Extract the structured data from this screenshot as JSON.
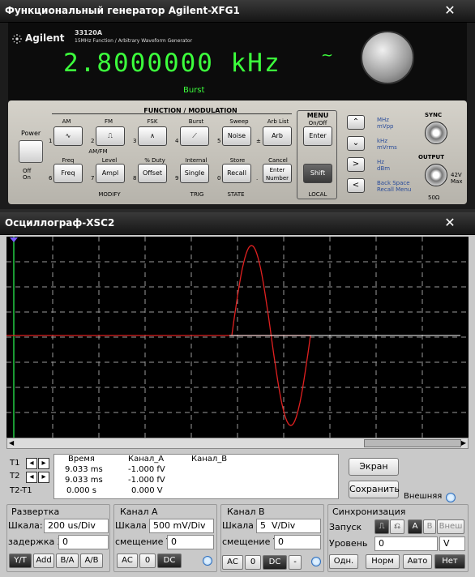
{
  "generator": {
    "title": "Функциональный генератор Agilent-XFG1",
    "close_glyph": "✕",
    "brand": "Agilent",
    "model": "33120A",
    "model_sub": "15MHz Function / Arbitrary Waveform Generator",
    "frequency": "2.8000000 kHz",
    "wave_symbol": "~",
    "burst": "Burst",
    "power_label": "Power",
    "off_label": "Off",
    "on_label": "On",
    "headers": {
      "function_modulation": "FUNCTION / MODULATION",
      "am_fm": "AM/FM",
      "modify": "MODIFY",
      "trig": "TRIG",
      "state": "STATE",
      "menu": "MENU",
      "menu_sub": "On/Off",
      "local": "LOCAL",
      "sync": "SYNC",
      "output": "OUTPUT",
      "ohm": "50Ω",
      "max": "42V Max"
    },
    "top_labels": [
      "AM",
      "FM",
      "FSK",
      "Burst",
      "Sweep",
      "Arb List"
    ],
    "top_buttons": [
      "∿",
      "⎍",
      "∧",
      "⟋",
      "Noise",
      "Arb"
    ],
    "top_numbers": [
      "1",
      "2",
      "3",
      "4",
      "5",
      "±"
    ],
    "bottom_labels": [
      "Freq",
      "Level",
      "% Duty",
      "Internal",
      "Store",
      "Cancel"
    ],
    "bottom_buttons": [
      "Freq",
      "Ampl",
      "Offset",
      "Single",
      "Recall",
      "Enter Number"
    ],
    "bottom_numbers": [
      "6",
      "7",
      "8",
      "9",
      "0",
      "."
    ],
    "enter": "Enter",
    "shift": "Shift",
    "arrows": [
      "⌃",
      "⌄",
      ">",
      "<"
    ],
    "side_labels": [
      "MHz\nmVpp",
      "kHz\nmVrms",
      "Hz\ndBm",
      "Back Space\nRecall Menu"
    ]
  },
  "oscilloscope": {
    "title": "Осциллограф-XSC2",
    "close_glyph": "✕",
    "meas_headers": [
      "Время",
      "Канал_A",
      "Канал_B"
    ],
    "rows": [
      {
        "label": "T1",
        "time": "9.033 ms",
        "a": "-1.000 fV",
        "b": ""
      },
      {
        "label": "T2",
        "time": "9.033 ms",
        "a": "-1.000 fV",
        "b": ""
      },
      {
        "label": "T2-T1",
        "time": "0.000 s",
        "a": "0.000 V",
        "b": ""
      }
    ],
    "screen_btn": "Экран",
    "save_btn": "Сохранить",
    "external": "Внешняя",
    "timebase": {
      "title": "Развертка",
      "scale_label": "Шкала:",
      "scale_value": "200 us/Div",
      "delay_label": "задержка X",
      "delay_value": "0",
      "buttons": [
        "Y/T",
        "Add",
        "B/A",
        "A/B"
      ]
    },
    "channel_a": {
      "title": "Канал A",
      "scale_label": "Шкала",
      "scale_value": "500 mV/Div",
      "offset_label": "смещение Y",
      "offset_value": "0",
      "buttons": [
        "AC",
        "0",
        "DC"
      ]
    },
    "channel_b": {
      "title": "Канал B",
      "scale_label": "Шкала",
      "scale_value": "5  V/Div",
      "offset_label": "смещение Y",
      "offset_value": "0",
      "buttons": [
        "AC",
        "0",
        "DC",
        "-"
      ]
    },
    "trigger": {
      "title": "Синхронизация",
      "start_label": "Запуск",
      "edge_buttons": [
        "⎍",
        "⎌",
        "A",
        "B",
        "Внеш"
      ],
      "level_label": "Уровень",
      "level_value": "0",
      "level_unit": "V",
      "mode_buttons": [
        "Одн.",
        "Норм",
        "Авто",
        "Нет"
      ]
    },
    "trace_color": "#e02020"
  }
}
